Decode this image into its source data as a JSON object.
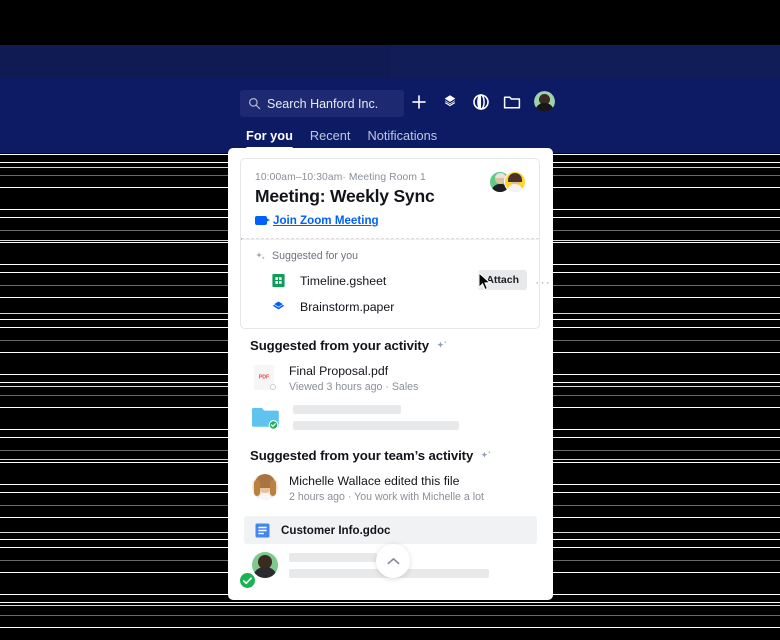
{
  "topbar": {
    "search": {
      "placeholder": "Search Hanford Inc.",
      "value": "",
      "icon": "search-icon"
    },
    "icons": [
      {
        "name": "plus-icon",
        "label": "Create new"
      },
      {
        "name": "dropbox-logo-icon",
        "label": "Dropbox"
      },
      {
        "name": "globe-icon",
        "label": "Globe"
      },
      {
        "name": "folder-icon",
        "label": "Files"
      },
      {
        "name": "user-avatar-icon",
        "label": "Account"
      }
    ],
    "tabs": [
      {
        "label": "For you",
        "active": true
      },
      {
        "label": "Recent",
        "active": false
      },
      {
        "label": "Notifications",
        "active": false
      }
    ]
  },
  "meeting_card": {
    "time": "10:00am–10:30am",
    "separator": "·",
    "location": "Meeting Room 1",
    "title": "Meeting: Weekly Sync",
    "join_link": "Join Zoom Meeting",
    "suggested_label": "Suggested for you",
    "suggested_icon": "sparkle-icon",
    "files": [
      {
        "name": "Timeline.gsheet",
        "icon": "google-sheets-icon",
        "action_label": "Attach",
        "overflow_label": "···"
      },
      {
        "name": "Brainstorm.paper",
        "icon": "dropbox-paper-icon"
      }
    ]
  },
  "sections": [
    {
      "title": "Suggested from your activity",
      "icon": "sparkle-icon",
      "items": [
        {
          "name": "Final Proposal.pdf",
          "meta": "Viewed 3 hours ago · Sales",
          "icon": "pdf-file-icon"
        },
        {
          "name": "",
          "meta": "",
          "icon": "folder-synced-icon"
        }
      ]
    },
    {
      "title": "Suggested from your team’s activity",
      "icon": "sparkle-icon",
      "items": [
        {
          "name": "Michelle Wallace edited this file",
          "meta": "2 hours ago · You work with Michelle a lot",
          "icon": "avatar-michelle"
        },
        {
          "name": "Customer Info.gdoc",
          "icon": "google-docs-icon"
        }
      ]
    }
  ],
  "collapse_button": {
    "icon": "chevron-up-icon",
    "label": "Collapse"
  },
  "status_badge": {
    "icon": "check-circle-icon",
    "label": "Synced"
  },
  "colors": {
    "navy": "#0d1b65",
    "navy_band": "#0f1b52",
    "search_field": "#1d2a72",
    "link_blue": "#0061fe",
    "sheets_green": "#0f9d58",
    "paper_blue": "#0061fe",
    "pdf_red": "#f03f3f",
    "folder_blue": "#5ec3ef",
    "check_green": "#19b352",
    "attach_bg": "#e8e9eb",
    "panel_bg": "#ffffff",
    "muted_text": "#8a8f98",
    "ghost_gray": "#e8e9eb"
  }
}
